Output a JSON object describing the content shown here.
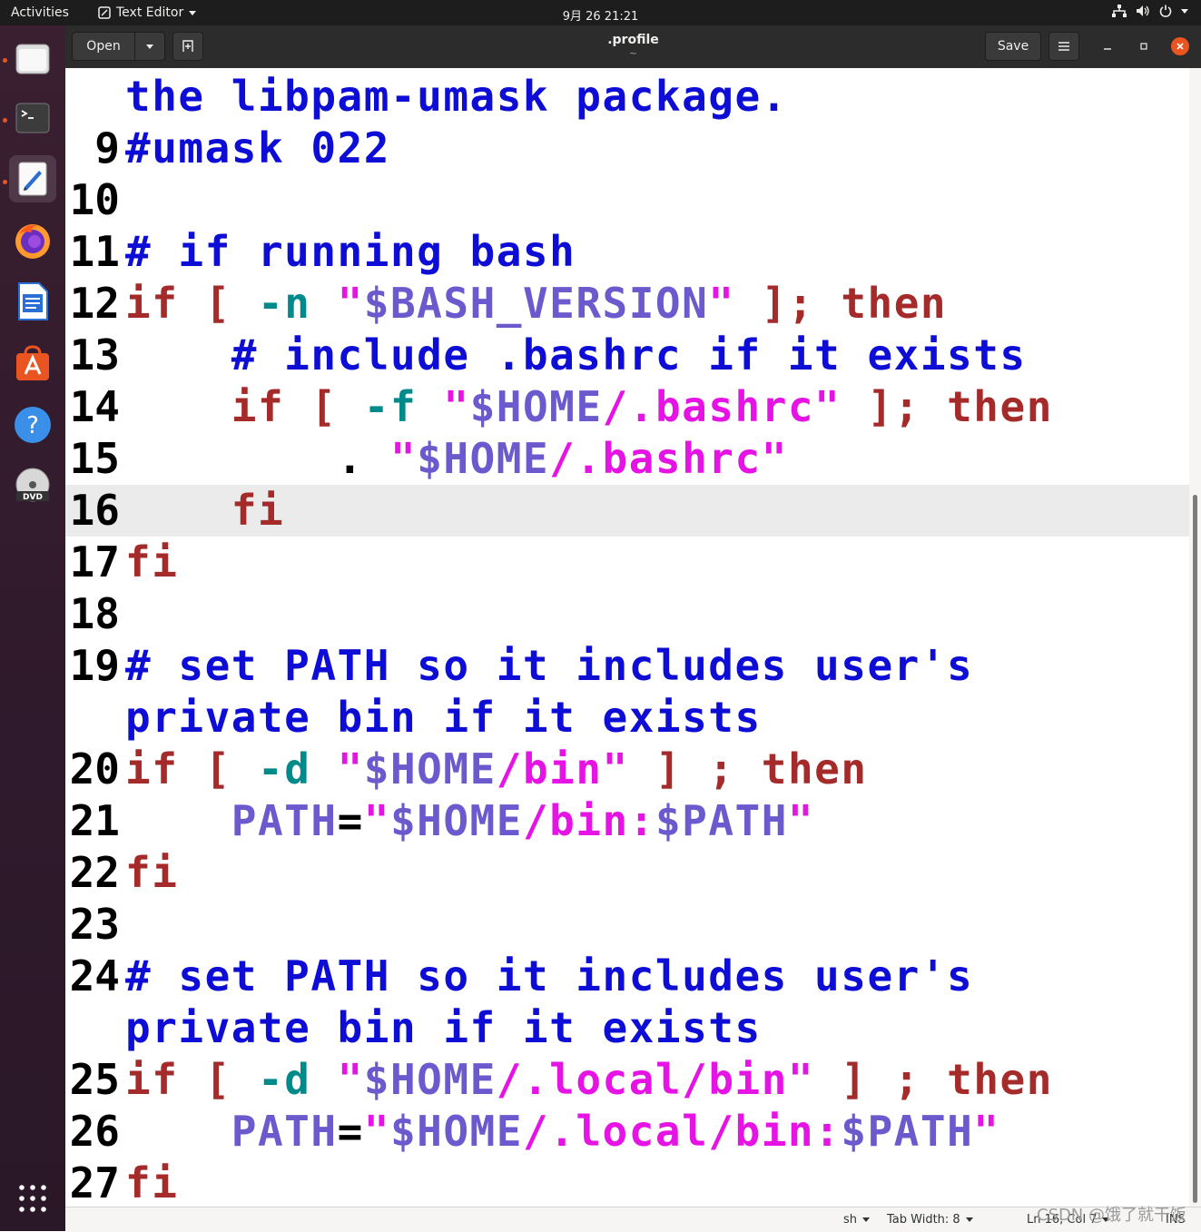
{
  "topbar": {
    "activities": "Activities",
    "app_name": "Text Editor",
    "clock": "9月 26  21:21"
  },
  "header": {
    "open_label": "Open",
    "title": ".profile",
    "subtitle": "~",
    "save_label": "Save"
  },
  "editor": {
    "current_line": "16",
    "lines": [
      {
        "num": "",
        "segs": [
          [
            "cm",
            "the libpam-umask package."
          ]
        ]
      },
      {
        "num": "9",
        "segs": [
          [
            "cm",
            "#umask 022"
          ]
        ]
      },
      {
        "num": "10",
        "segs": []
      },
      {
        "num": "11",
        "segs": [
          [
            "cm",
            "# if running bash"
          ]
        ]
      },
      {
        "num": "12",
        "segs": [
          [
            "kw",
            "if"
          ],
          [
            "pl",
            " "
          ],
          [
            "kw",
            "["
          ],
          [
            "pl",
            " "
          ],
          [
            "op",
            "-n"
          ],
          [
            "pl",
            " "
          ],
          [
            "st",
            "\""
          ],
          [
            "va",
            "$BASH_VERSION"
          ],
          [
            "st",
            "\""
          ],
          [
            "pl",
            " "
          ],
          [
            "kw",
            "];"
          ],
          [
            "pl",
            " "
          ],
          [
            "kw",
            "then"
          ]
        ]
      },
      {
        "num": "13",
        "segs": [
          [
            "pl",
            "    "
          ],
          [
            "cm",
            "# include .bashrc if it exists"
          ]
        ]
      },
      {
        "num": "14",
        "segs": [
          [
            "pl",
            "    "
          ],
          [
            "kw",
            "if"
          ],
          [
            "pl",
            " "
          ],
          [
            "kw",
            "["
          ],
          [
            "pl",
            " "
          ],
          [
            "op",
            "-f"
          ],
          [
            "pl",
            " "
          ],
          [
            "st",
            "\""
          ],
          [
            "va",
            "$HOME"
          ],
          [
            "st",
            "/.bashrc\""
          ],
          [
            "pl",
            " "
          ],
          [
            "kw",
            "];"
          ],
          [
            "pl",
            " "
          ],
          [
            "kw",
            "then"
          ]
        ]
      },
      {
        "num": "15",
        "segs": [
          [
            "pl",
            "        . "
          ],
          [
            "st",
            "\""
          ],
          [
            "va",
            "$HOME"
          ],
          [
            "st",
            "/.bashrc\""
          ]
        ]
      },
      {
        "num": "16",
        "segs": [
          [
            "pl",
            "    "
          ],
          [
            "kw",
            "fi"
          ]
        ]
      },
      {
        "num": "17",
        "segs": [
          [
            "kw",
            "fi"
          ]
        ]
      },
      {
        "num": "18",
        "segs": []
      },
      {
        "num": "19",
        "segs": [
          [
            "cm",
            "# set PATH so it includes user's"
          ]
        ]
      },
      {
        "num": "",
        "segs": [
          [
            "cm",
            "private bin if it exists"
          ]
        ]
      },
      {
        "num": "20",
        "segs": [
          [
            "kw",
            "if"
          ],
          [
            "pl",
            " "
          ],
          [
            "kw",
            "["
          ],
          [
            "pl",
            " "
          ],
          [
            "op",
            "-d"
          ],
          [
            "pl",
            " "
          ],
          [
            "st",
            "\""
          ],
          [
            "va",
            "$HOME"
          ],
          [
            "st",
            "/bin\""
          ],
          [
            "pl",
            " "
          ],
          [
            "kw",
            "]"
          ],
          [
            "pl",
            " "
          ],
          [
            "kw",
            ";"
          ],
          [
            "pl",
            " "
          ],
          [
            "kw",
            "then"
          ]
        ]
      },
      {
        "num": "21",
        "segs": [
          [
            "pl",
            "    "
          ],
          [
            "va",
            "PATH"
          ],
          [
            "pl",
            "="
          ],
          [
            "st",
            "\""
          ],
          [
            "va",
            "$HOME"
          ],
          [
            "st",
            "/bin:"
          ],
          [
            "va",
            "$PATH"
          ],
          [
            "st",
            "\""
          ]
        ]
      },
      {
        "num": "22",
        "segs": [
          [
            "kw",
            "fi"
          ]
        ]
      },
      {
        "num": "23",
        "segs": []
      },
      {
        "num": "24",
        "segs": [
          [
            "cm",
            "# set PATH so it includes user's"
          ]
        ]
      },
      {
        "num": "",
        "segs": [
          [
            "cm",
            "private bin if it exists"
          ]
        ]
      },
      {
        "num": "25",
        "segs": [
          [
            "kw",
            "if"
          ],
          [
            "pl",
            " "
          ],
          [
            "kw",
            "["
          ],
          [
            "pl",
            " "
          ],
          [
            "op",
            "-d"
          ],
          [
            "pl",
            " "
          ],
          [
            "st",
            "\""
          ],
          [
            "va",
            "$HOME"
          ],
          [
            "st",
            "/.local/bin\""
          ],
          [
            "pl",
            " "
          ],
          [
            "kw",
            "]"
          ],
          [
            "pl",
            " "
          ],
          [
            "kw",
            ";"
          ],
          [
            "pl",
            " "
          ],
          [
            "kw",
            "then"
          ]
        ]
      },
      {
        "num": "26",
        "segs": [
          [
            "pl",
            "    "
          ],
          [
            "va",
            "PATH"
          ],
          [
            "pl",
            "="
          ],
          [
            "st",
            "\""
          ],
          [
            "va",
            "$HOME"
          ],
          [
            "st",
            "/.local/bin:"
          ],
          [
            "va",
            "$PATH"
          ],
          [
            "st",
            "\""
          ]
        ]
      },
      {
        "num": "27",
        "segs": [
          [
            "kw",
            "fi"
          ]
        ]
      }
    ]
  },
  "status": {
    "language": "sh",
    "tab_width": "Tab Width: 8",
    "position": "Ln 16, Col 7",
    "mode": "INS"
  },
  "watermark": "CSDN @饿了就干饭",
  "colors": {
    "comment": "#0d0dd6",
    "keyword": "#a52a2a",
    "string": "#e514e5",
    "operator": "#008a8c",
    "variable": "#6a5acd",
    "accent": "#e95420"
  }
}
